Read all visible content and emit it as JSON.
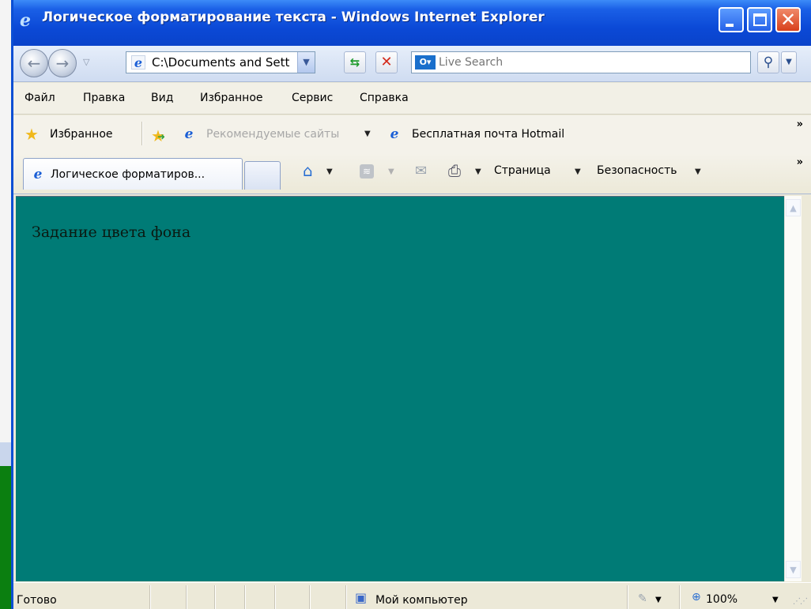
{
  "window": {
    "title": "Логическое форматирование текста - Windows Internet Explorer",
    "close_glyph": "✕"
  },
  "address_bar": {
    "url": "C:\\Documents and Setti",
    "search_placeholder": "Live Search",
    "live_label": "O▾"
  },
  "menu": {
    "items": [
      "Файл",
      "Правка",
      "Вид",
      "Избранное",
      "Сервис",
      "Справка"
    ]
  },
  "favorites_bar": {
    "favorites_label": "Избранное",
    "suggested_sites": "Рекомендуемые сайты",
    "hotmail": "Бесплатная почта Hotmail",
    "chevron": "»"
  },
  "tabs": {
    "active_tab_label": "Логическое форматиров..."
  },
  "command_bar": {
    "page_label": "Страница",
    "safety_label": "Безопасность"
  },
  "content": {
    "text": "Задание цвета фона",
    "background_color": "#007b76"
  },
  "status_bar": {
    "ready": "Готово",
    "zone": "Мой компьютер",
    "zoom": "100%"
  },
  "colors": {
    "titlebar": "#0b49d6",
    "desktop": "#0a8a12"
  }
}
